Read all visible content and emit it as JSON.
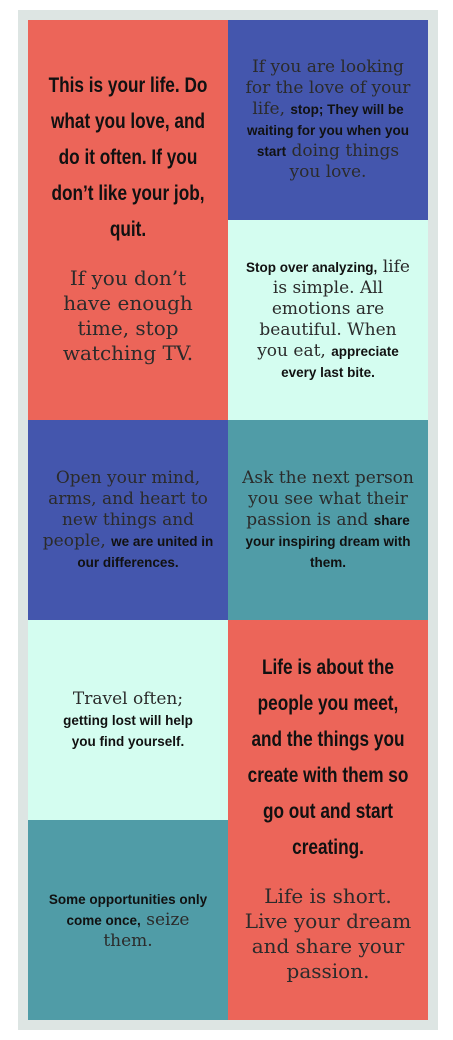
{
  "colors": {
    "coral": "#ec6559",
    "blue": "#4456ad",
    "mint": "#d4fdf0",
    "teal": "#509ca7",
    "frame": "#dde5e3"
  },
  "tiles": {
    "t1": {
      "heading": "This is your life. Do what you love, and do it often. If you don’t like your job, quit.",
      "text": "If you don’t have enough time, stop watching TV."
    },
    "t2": {
      "pre": "If you are looking for the love of your life,",
      "bold": "stop; They will be waiting for you when you start",
      "post": "doing things you love."
    },
    "t3": {
      "bold1": "Stop over analyzing,",
      "mid": "life is simple. All emotions are beautiful. When you eat,",
      "bold2": "appreciate every last bite."
    },
    "t4": {
      "pre": "Open your mind, arms, and heart to new things and people,",
      "bold": "we are united in our differences."
    },
    "t5": {
      "pre": "Ask the next person you see what their passion is and",
      "bold": "share your inspiring dream with them."
    },
    "t6": {
      "pre": "Travel often;",
      "bold": "getting lost will help you find yourself."
    },
    "t7": {
      "heading": "Life is about the people you meet, and the things you create with them so go out and start creating.",
      "text": "Life is short. Live your dream and share your passion."
    },
    "t8": {
      "bold": "Some opportunities only come once,",
      "post": "seize them."
    }
  }
}
